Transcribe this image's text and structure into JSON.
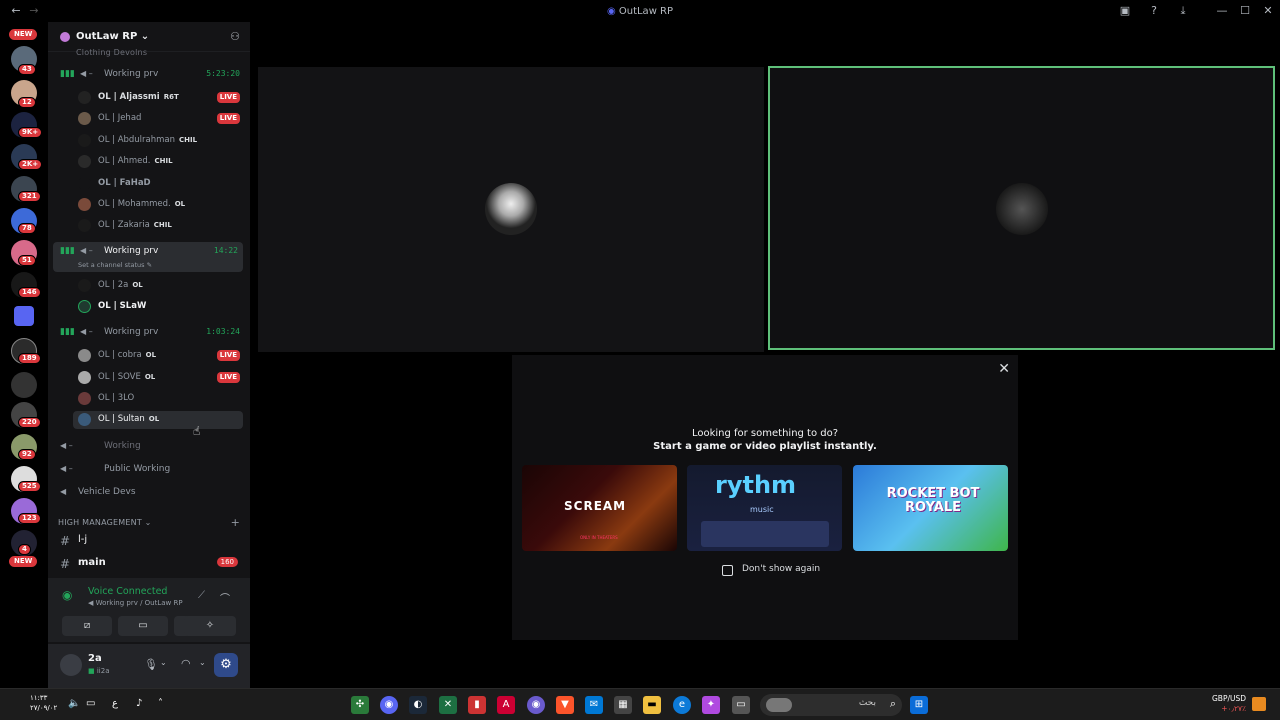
{
  "window": {
    "title": "OutLaw RP"
  },
  "guilds": {
    "new_top": "NEW",
    "new_bottom": "NEW",
    "badges": [
      "43",
      "12",
      "9K+",
      "2K+",
      "321",
      "78",
      "51",
      "146",
      "189",
      "220",
      "92",
      "525",
      "123",
      "4"
    ]
  },
  "server": {
    "name": "OutLaw RP",
    "partial_top": "Clothing Devolns"
  },
  "channels": [
    {
      "name": "Working prv",
      "time": "5:23:20",
      "users": [
        {
          "name": "OL | Aljassmi",
          "tag": "R6T",
          "live": "LIVE",
          "bold": true
        },
        {
          "name": "OL | Jehad",
          "tag": "",
          "live": "LIVE"
        },
        {
          "name": "OL | Abdulrahman",
          "tag": "CHIL",
          "live": ""
        },
        {
          "name": "OL | Ahmed.",
          "tag": "CHIL",
          "live": ""
        },
        {
          "name": "OL | FaHaD",
          "tag": "",
          "live": "",
          "bold": true
        },
        {
          "name": "OL | Mohammed.",
          "tag": "OL",
          "live": ""
        },
        {
          "name": "OL | Zakaria",
          "tag": "CHIL",
          "live": ""
        }
      ]
    },
    {
      "name": "Working prv",
      "time": "14:22",
      "status": "Set a channel status",
      "users": [
        {
          "name": "OL | 2a",
          "tag": "OL",
          "live": ""
        },
        {
          "name": "OL | SLaW",
          "tag": "",
          "live": ""
        }
      ]
    },
    {
      "name": "Working prv",
      "time": "1:03:24",
      "users": [
        {
          "name": "OL | cobra",
          "tag": "OL",
          "live": "LIVE"
        },
        {
          "name": "OL | SOVE",
          "tag": "OL",
          "live": "LIVE"
        },
        {
          "name": "OL | 3LO",
          "tag": "",
          "live": ""
        },
        {
          "name": "OL | Sultan",
          "tag": "OL",
          "live": ""
        }
      ]
    }
  ],
  "other_voice": [
    "Working",
    "Public Working",
    "Vehicle Devs"
  ],
  "category": "HIGH MANAGEMENT",
  "text_channels": [
    {
      "name": "l-j",
      "badge": ""
    },
    {
      "name": "main",
      "badge": "160"
    }
  ],
  "voice_panel": {
    "status": "Voice Connected",
    "location": "Working prv / OutLaw RP"
  },
  "user_panel": {
    "name": "2a",
    "sub": "ii2a"
  },
  "modal": {
    "line1": "Looking for something to do?",
    "line2": "Start a game or video playlist instantly.",
    "cards": [
      "SCREAM",
      "rythm",
      "ROCKET BOT ROYALE"
    ],
    "card_sub": {
      "scream": "ONLY IN THEATERS",
      "rythm": "music"
    },
    "checkbox": "Don't show again"
  },
  "taskbar": {
    "time": "١١:٣٣",
    "date": "٢٧/٠٩/٠٢",
    "lang": "ع",
    "search": "بحث",
    "ticker": "GBP/USD",
    "ticker_change": "+٠٫٢٧٪"
  },
  "colors": {
    "accent_green": "#23a55a",
    "live_red": "#da373c",
    "speaking_border": "#5fc07a"
  }
}
